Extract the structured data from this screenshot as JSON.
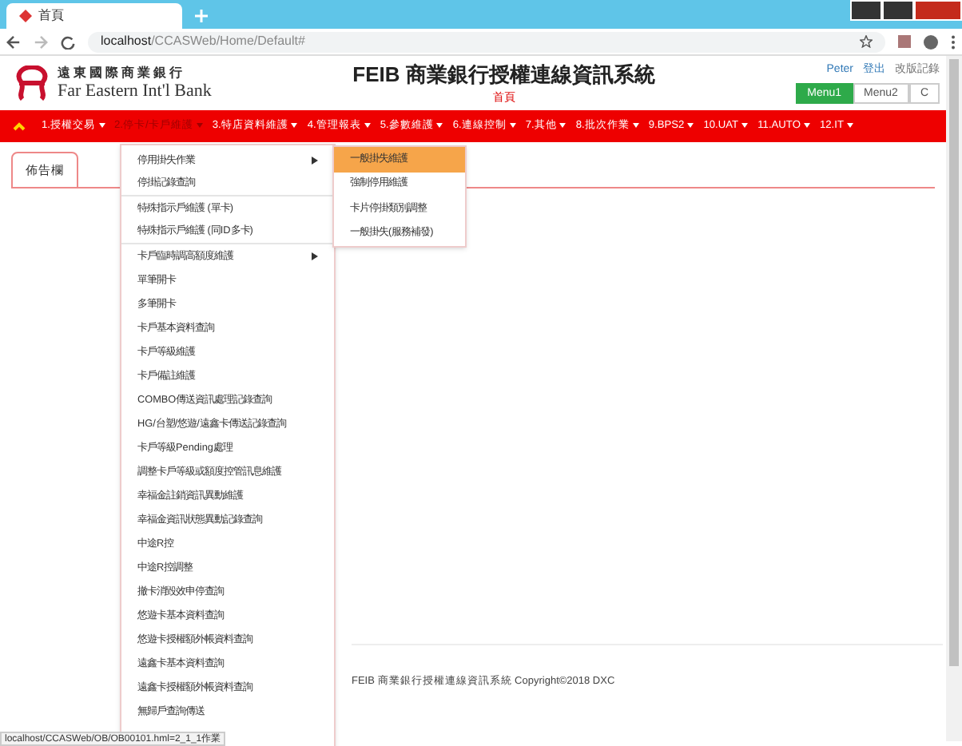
{
  "browser": {
    "tab_title": "首頁",
    "url_host": "localhost",
    "url_path": "/CCASWeb/Home/Default#"
  },
  "header": {
    "bank_name_zh": "遠東國際商業銀行",
    "bank_name_en": "Far Eastern Int'l Bank",
    "title": "FEIB 商業銀行授權連線資訊系統",
    "subtitle": "首頁",
    "user": "Peter",
    "logout": "登出",
    "changelog": "改版記錄",
    "menu_switch": [
      {
        "label": "Menu1",
        "selected": true
      },
      {
        "label": "Menu2",
        "selected": false
      },
      {
        "label": "C",
        "selected": false
      }
    ]
  },
  "nav": [
    {
      "label": "1.授權交易",
      "selected": false
    },
    {
      "label": "2.停卡/卡戶維護",
      "selected": true
    },
    {
      "label": "3.特店資料維護",
      "selected": false
    },
    {
      "label": "4.管理報表",
      "selected": false
    },
    {
      "label": "5.參數維護",
      "selected": false
    },
    {
      "label": "6.連線控制",
      "selected": false
    },
    {
      "label": "7.其他",
      "selected": false
    },
    {
      "label": "8.批次作業",
      "selected": false
    },
    {
      "label": "9.BPS2",
      "selected": false
    },
    {
      "label": "10.UAT",
      "selected": false
    },
    {
      "label": "11.AUTO",
      "selected": false
    },
    {
      "label": "12.IT",
      "selected": false
    }
  ],
  "dropdown": [
    {
      "label": "停用掛失作業",
      "has_submenu": true,
      "divider": false
    },
    {
      "label": "停掛記錄查詢",
      "has_submenu": false,
      "divider": true
    },
    {
      "label": "特殊指示戶維護 (單卡)",
      "has_submenu": false,
      "divider": false
    },
    {
      "label": "特殊指示戶維護 (同ID多卡)",
      "has_submenu": false,
      "divider": true
    },
    {
      "label": "卡戶臨時調高額度維護",
      "has_submenu": true,
      "divider": false
    },
    {
      "label": "單筆開卡",
      "has_submenu": false,
      "divider": false
    },
    {
      "label": "多筆開卡",
      "has_submenu": false,
      "divider": false
    },
    {
      "label": "卡戶基本資料查詢",
      "has_submenu": false,
      "divider": false
    },
    {
      "label": "卡戶等級維護",
      "has_submenu": false,
      "divider": false
    },
    {
      "label": "卡戶備註維護",
      "has_submenu": false,
      "divider": false
    },
    {
      "label": "COMBO傳送資訊處理記錄查詢",
      "has_submenu": false,
      "divider": false
    },
    {
      "label": "HG/台塑/悠遊/遠鑫卡傳送記錄查詢",
      "has_submenu": false,
      "divider": false
    },
    {
      "label": "卡戶等級Pending處理",
      "has_submenu": false,
      "divider": false
    },
    {
      "label": "調整卡戶等級或額度控管訊息維護",
      "has_submenu": false,
      "divider": false
    },
    {
      "label": "幸福金註銷資訊異動維護",
      "has_submenu": false,
      "divider": false
    },
    {
      "label": "幸福金資訊狀態異動記錄查詢",
      "has_submenu": false,
      "divider": false
    },
    {
      "label": "中途R控",
      "has_submenu": false,
      "divider": false
    },
    {
      "label": "中途R控調整",
      "has_submenu": false,
      "divider": false
    },
    {
      "label": "撤卡消毀效申停查詢",
      "has_submenu": false,
      "divider": false
    },
    {
      "label": "悠遊卡基本資料查詢",
      "has_submenu": false,
      "divider": false
    },
    {
      "label": "悠遊卡授權額外帳資料查詢",
      "has_submenu": false,
      "divider": false
    },
    {
      "label": "遠鑫卡基本資料查詢",
      "has_submenu": false,
      "divider": false
    },
    {
      "label": "遠鑫卡授權額外帳資料查詢",
      "has_submenu": false,
      "divider": false
    },
    {
      "label": "無歸戶查詢傳送",
      "has_submenu": false,
      "divider": false
    }
  ],
  "submenu": [
    {
      "label": "一般掛失維護",
      "selected": true
    },
    {
      "label": "強制停用維護",
      "selected": false
    },
    {
      "label": "卡片停掛類別調整",
      "selected": false
    },
    {
      "label": "一般掛失(服務補發)",
      "selected": false
    }
  ],
  "content_tab": {
    "label": "佈告欄",
    "selected": true
  },
  "footer": "FEIB 商業銀行授權連線資訊系統 Copyright©2018 DXC",
  "status_url": "localhost/CCASWeb/OB/OB00101.hml=2_1_1作業"
}
